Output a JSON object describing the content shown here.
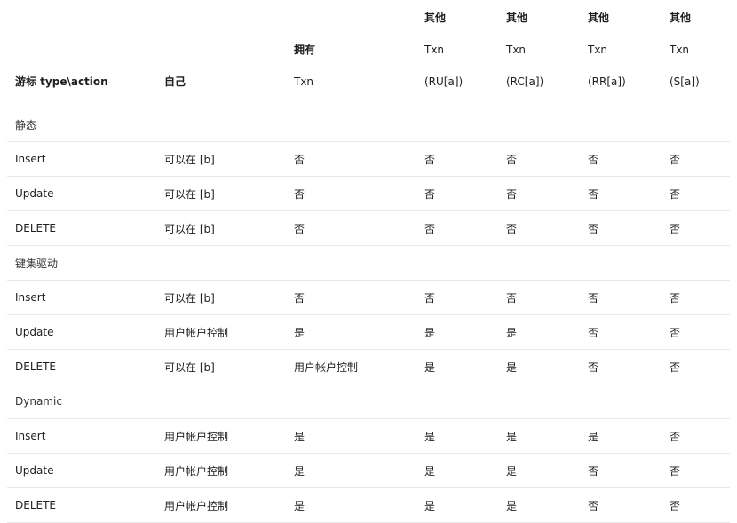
{
  "header": {
    "cursor": {
      "line1": "",
      "line2": "",
      "line3": "游标 type\\action"
    },
    "own": {
      "line1": "",
      "line2": "",
      "line3": "自己"
    },
    "owner": {
      "line1": "",
      "line2": "拥有",
      "line3": "Txn"
    },
    "other_ru": {
      "line1": "其他",
      "line2": "Txn",
      "line3": "(RU[a])"
    },
    "other_rc": {
      "line1": "其他",
      "line2": "Txn",
      "line3": "(RC[a])"
    },
    "other_rr": {
      "line1": "其他",
      "line2": "Txn",
      "line3": "(RR[a])"
    },
    "other_s": {
      "line1": "其他",
      "line2": "Txn",
      "line3": "(S[a])"
    }
  },
  "rows": [
    {
      "type": "section",
      "label": "静态"
    },
    {
      "type": "data",
      "cells": [
        "Insert",
        "可以在 [b]",
        "否",
        "否",
        "否",
        "否",
        "否"
      ]
    },
    {
      "type": "data",
      "cells": [
        "Update",
        "可以在 [b]",
        "否",
        "否",
        "否",
        "否",
        "否"
      ]
    },
    {
      "type": "data",
      "cells": [
        "DELETE",
        "可以在 [b]",
        "否",
        "否",
        "否",
        "否",
        "否"
      ]
    },
    {
      "type": "section",
      "label": "键集驱动"
    },
    {
      "type": "data",
      "cells": [
        "Insert",
        "可以在 [b]",
        "否",
        "否",
        "否",
        "否",
        "否"
      ]
    },
    {
      "type": "data",
      "cells": [
        "Update",
        "用户帐户控制",
        "是",
        "是",
        "是",
        "否",
        "否"
      ]
    },
    {
      "type": "data",
      "cells": [
        "DELETE",
        "可以在 [b]",
        "用户帐户控制",
        "是",
        "是",
        "否",
        "否"
      ]
    },
    {
      "type": "section",
      "label": "Dynamic"
    },
    {
      "type": "data",
      "cells": [
        "Insert",
        "用户帐户控制",
        "是",
        "是",
        "是",
        "是",
        "否"
      ]
    },
    {
      "type": "data",
      "cells": [
        "Update",
        "用户帐户控制",
        "是",
        "是",
        "是",
        "否",
        "否"
      ]
    },
    {
      "type": "data",
      "cells": [
        "DELETE",
        "用户帐户控制",
        "是",
        "是",
        "是",
        "否",
        "否"
      ]
    }
  ]
}
